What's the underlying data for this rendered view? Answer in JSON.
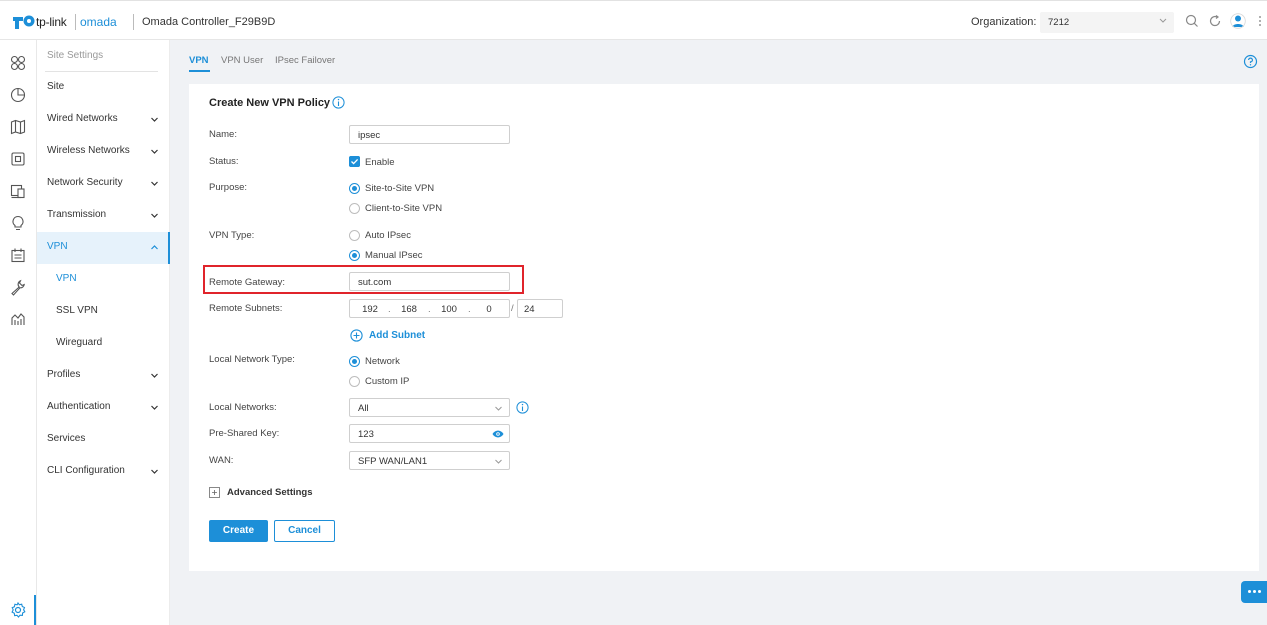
{
  "header": {
    "brand_tplink": "tp-link",
    "brand_omada": "omada",
    "controller_name": "Omada Controller_F29B9D",
    "org_label": "Organization:",
    "org_value": "7212"
  },
  "menu": {
    "header": "Site Settings",
    "items": [
      {
        "label": "Site"
      },
      {
        "label": "Wired Networks"
      },
      {
        "label": "Wireless Networks"
      },
      {
        "label": "Network Security"
      },
      {
        "label": "Transmission"
      },
      {
        "label": "VPN"
      },
      {
        "label": "VPN"
      },
      {
        "label": "SSL VPN"
      },
      {
        "label": "Wireguard"
      },
      {
        "label": "Profiles"
      },
      {
        "label": "Authentication"
      },
      {
        "label": "Services"
      },
      {
        "label": "CLI Configuration"
      }
    ]
  },
  "tabs": [
    "VPN",
    "VPN User",
    "IPsec Failover"
  ],
  "form": {
    "title": "Create New VPN Policy",
    "name_label": "Name:",
    "name_value": "ipsec",
    "status_label": "Status:",
    "status_option": "Enable",
    "purpose_label": "Purpose:",
    "purpose_options": [
      "Site-to-Site VPN",
      "Client-to-Site VPN"
    ],
    "vpn_type_label": "VPN Type:",
    "vpn_type_options": [
      "Auto IPsec",
      "Manual IPsec"
    ],
    "remote_gateway_label": "Remote Gateway:",
    "remote_gateway_value": "sut.com",
    "remote_subnets_label": "Remote Subnets:",
    "subnet_octets": [
      "192",
      "168",
      "100",
      "0"
    ],
    "subnet_prefix": "24",
    "add_subnet": "Add Subnet",
    "local_network_type_label": "Local Network Type:",
    "local_network_type_options": [
      "Network",
      "Custom IP"
    ],
    "local_networks_label": "Local Networks:",
    "local_networks_value": "All",
    "psk_label": "Pre-Shared Key:",
    "psk_value": "123",
    "wan_label": "WAN:",
    "wan_value": "SFP WAN/LAN1",
    "advanced_settings": "Advanced Settings",
    "create_button": "Create",
    "cancel_button": "Cancel"
  },
  "colors": {
    "accent": "#1d8fd8",
    "highlight": "#e0242b"
  }
}
